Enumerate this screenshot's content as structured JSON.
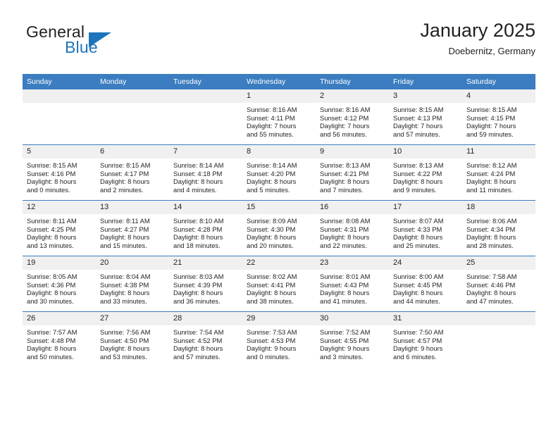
{
  "logo": {
    "word1": "General",
    "word2": "Blue",
    "triangle_color": "#1d74bb"
  },
  "header": {
    "title": "January 2025",
    "subtitle": "Doebernitz, Germany"
  },
  "theme": {
    "header_bar": "#3b7dc0",
    "daynum_band": "#f0f0f0",
    "text": "#231f20"
  },
  "weekdays": [
    "Sunday",
    "Monday",
    "Tuesday",
    "Wednesday",
    "Thursday",
    "Friday",
    "Saturday"
  ],
  "labels": {
    "sunrise_prefix": "Sunrise:",
    "sunset_prefix": "Sunset:",
    "daylight_prefix": "Daylight:"
  },
  "weeks": [
    [
      {
        "day": "",
        "lines": []
      },
      {
        "day": "",
        "lines": []
      },
      {
        "day": "",
        "lines": []
      },
      {
        "day": "1",
        "lines": [
          "Sunrise: 8:16 AM",
          "Sunset: 4:11 PM",
          "Daylight: 7 hours",
          "and 55 minutes."
        ]
      },
      {
        "day": "2",
        "lines": [
          "Sunrise: 8:16 AM",
          "Sunset: 4:12 PM",
          "Daylight: 7 hours",
          "and 56 minutes."
        ]
      },
      {
        "day": "3",
        "lines": [
          "Sunrise: 8:15 AM",
          "Sunset: 4:13 PM",
          "Daylight: 7 hours",
          "and 57 minutes."
        ]
      },
      {
        "day": "4",
        "lines": [
          "Sunrise: 8:15 AM",
          "Sunset: 4:15 PM",
          "Daylight: 7 hours",
          "and 59 minutes."
        ]
      }
    ],
    [
      {
        "day": "5",
        "lines": [
          "Sunrise: 8:15 AM",
          "Sunset: 4:16 PM",
          "Daylight: 8 hours",
          "and 0 minutes."
        ]
      },
      {
        "day": "6",
        "lines": [
          "Sunrise: 8:15 AM",
          "Sunset: 4:17 PM",
          "Daylight: 8 hours",
          "and 2 minutes."
        ]
      },
      {
        "day": "7",
        "lines": [
          "Sunrise: 8:14 AM",
          "Sunset: 4:18 PM",
          "Daylight: 8 hours",
          "and 4 minutes."
        ]
      },
      {
        "day": "8",
        "lines": [
          "Sunrise: 8:14 AM",
          "Sunset: 4:20 PM",
          "Daylight: 8 hours",
          "and 5 minutes."
        ]
      },
      {
        "day": "9",
        "lines": [
          "Sunrise: 8:13 AM",
          "Sunset: 4:21 PM",
          "Daylight: 8 hours",
          "and 7 minutes."
        ]
      },
      {
        "day": "10",
        "lines": [
          "Sunrise: 8:13 AM",
          "Sunset: 4:22 PM",
          "Daylight: 8 hours",
          "and 9 minutes."
        ]
      },
      {
        "day": "11",
        "lines": [
          "Sunrise: 8:12 AM",
          "Sunset: 4:24 PM",
          "Daylight: 8 hours",
          "and 11 minutes."
        ]
      }
    ],
    [
      {
        "day": "12",
        "lines": [
          "Sunrise: 8:11 AM",
          "Sunset: 4:25 PM",
          "Daylight: 8 hours",
          "and 13 minutes."
        ]
      },
      {
        "day": "13",
        "lines": [
          "Sunrise: 8:11 AM",
          "Sunset: 4:27 PM",
          "Daylight: 8 hours",
          "and 15 minutes."
        ]
      },
      {
        "day": "14",
        "lines": [
          "Sunrise: 8:10 AM",
          "Sunset: 4:28 PM",
          "Daylight: 8 hours",
          "and 18 minutes."
        ]
      },
      {
        "day": "15",
        "lines": [
          "Sunrise: 8:09 AM",
          "Sunset: 4:30 PM",
          "Daylight: 8 hours",
          "and 20 minutes."
        ]
      },
      {
        "day": "16",
        "lines": [
          "Sunrise: 8:08 AM",
          "Sunset: 4:31 PM",
          "Daylight: 8 hours",
          "and 22 minutes."
        ]
      },
      {
        "day": "17",
        "lines": [
          "Sunrise: 8:07 AM",
          "Sunset: 4:33 PM",
          "Daylight: 8 hours",
          "and 25 minutes."
        ]
      },
      {
        "day": "18",
        "lines": [
          "Sunrise: 8:06 AM",
          "Sunset: 4:34 PM",
          "Daylight: 8 hours",
          "and 28 minutes."
        ]
      }
    ],
    [
      {
        "day": "19",
        "lines": [
          "Sunrise: 8:05 AM",
          "Sunset: 4:36 PM",
          "Daylight: 8 hours",
          "and 30 minutes."
        ]
      },
      {
        "day": "20",
        "lines": [
          "Sunrise: 8:04 AM",
          "Sunset: 4:38 PM",
          "Daylight: 8 hours",
          "and 33 minutes."
        ]
      },
      {
        "day": "21",
        "lines": [
          "Sunrise: 8:03 AM",
          "Sunset: 4:39 PM",
          "Daylight: 8 hours",
          "and 36 minutes."
        ]
      },
      {
        "day": "22",
        "lines": [
          "Sunrise: 8:02 AM",
          "Sunset: 4:41 PM",
          "Daylight: 8 hours",
          "and 38 minutes."
        ]
      },
      {
        "day": "23",
        "lines": [
          "Sunrise: 8:01 AM",
          "Sunset: 4:43 PM",
          "Daylight: 8 hours",
          "and 41 minutes."
        ]
      },
      {
        "day": "24",
        "lines": [
          "Sunrise: 8:00 AM",
          "Sunset: 4:45 PM",
          "Daylight: 8 hours",
          "and 44 minutes."
        ]
      },
      {
        "day": "25",
        "lines": [
          "Sunrise: 7:58 AM",
          "Sunset: 4:46 PM",
          "Daylight: 8 hours",
          "and 47 minutes."
        ]
      }
    ],
    [
      {
        "day": "26",
        "lines": [
          "Sunrise: 7:57 AM",
          "Sunset: 4:48 PM",
          "Daylight: 8 hours",
          "and 50 minutes."
        ]
      },
      {
        "day": "27",
        "lines": [
          "Sunrise: 7:56 AM",
          "Sunset: 4:50 PM",
          "Daylight: 8 hours",
          "and 53 minutes."
        ]
      },
      {
        "day": "28",
        "lines": [
          "Sunrise: 7:54 AM",
          "Sunset: 4:52 PM",
          "Daylight: 8 hours",
          "and 57 minutes."
        ]
      },
      {
        "day": "29",
        "lines": [
          "Sunrise: 7:53 AM",
          "Sunset: 4:53 PM",
          "Daylight: 9 hours",
          "and 0 minutes."
        ]
      },
      {
        "day": "30",
        "lines": [
          "Sunrise: 7:52 AM",
          "Sunset: 4:55 PM",
          "Daylight: 9 hours",
          "and 3 minutes."
        ]
      },
      {
        "day": "31",
        "lines": [
          "Sunrise: 7:50 AM",
          "Sunset: 4:57 PM",
          "Daylight: 9 hours",
          "and 6 minutes."
        ]
      },
      {
        "day": "",
        "lines": []
      }
    ]
  ]
}
